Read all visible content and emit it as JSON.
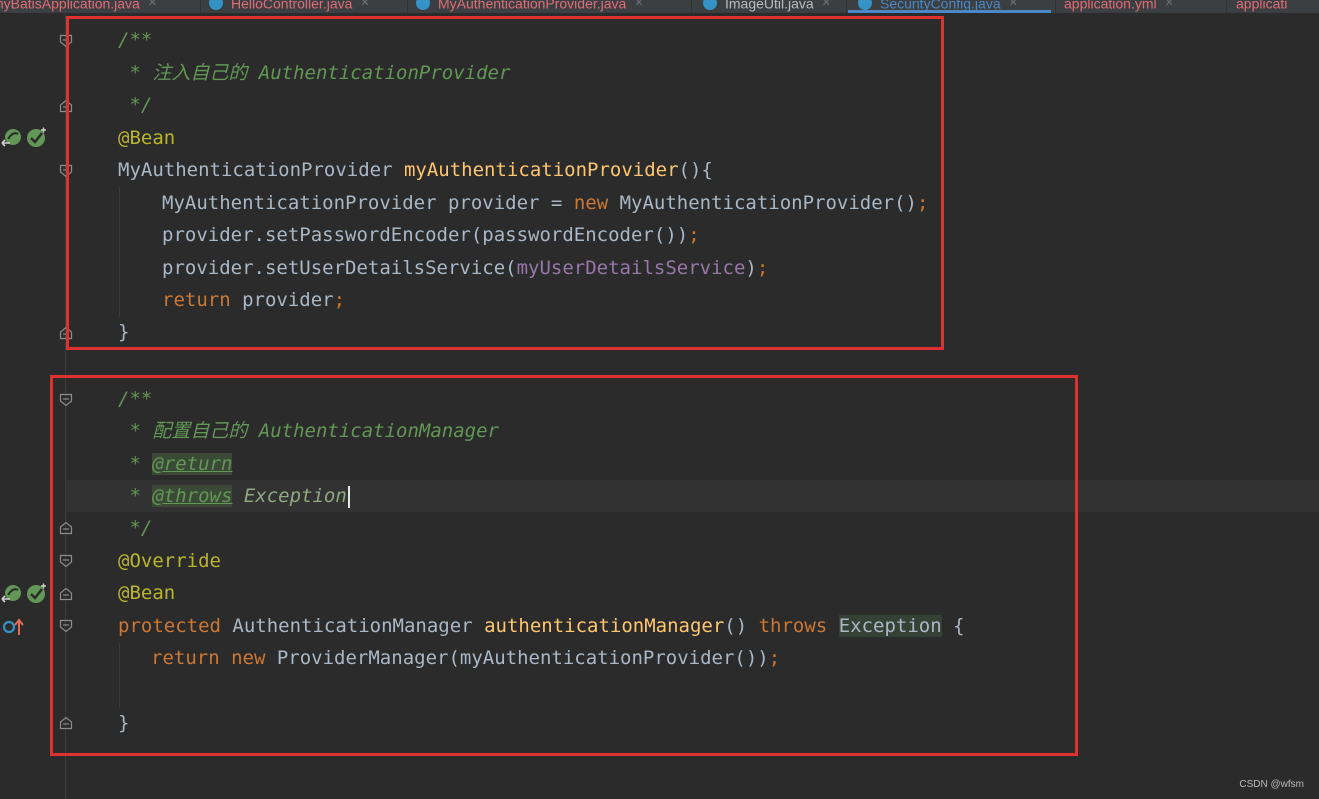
{
  "tabs": [
    {
      "label": "myBatisApplication.java",
      "state": "error"
    },
    {
      "label": "HelloController.java",
      "state": "error"
    },
    {
      "label": "MyAuthenticationProvider.java",
      "state": "error"
    },
    {
      "label": "ImageUtil.java",
      "state": "normal"
    },
    {
      "label": "SecurityConfig.java",
      "state": "active"
    },
    {
      "label": "application.yml",
      "state": "error"
    },
    {
      "label": "applicati",
      "state": "error"
    }
  ],
  "code": {
    "l1": "/**",
    "l2": " * 注入自己的 AuthenticationProvider",
    "l3": " */",
    "l4": "@Bean",
    "l5_type": "MyAuthenticationProvider ",
    "l5_fn": "myAuthenticationProvider",
    "l5_tail": "(){",
    "l6_a": "MyAuthenticationProvider provider = ",
    "l6_kw": "new",
    "l6_b": " MyAuthenticationProvider()",
    "l6_semi": ";",
    "l7_a": "provider.setPasswordEncoder(passwordEncoder())",
    "l7_semi": ";",
    "l8_a": "provider.setUserDetailsService(",
    "l8_field": "myUserDetailsService",
    "l8_b": ")",
    "l8_semi": ";",
    "l9_kw": "return",
    "l9_a": " provider",
    "l9_semi": ";",
    "l10": "}",
    "l11": "/**",
    "l12": " * 配置自己的 AuthenticationManager",
    "l13_star": " * ",
    "l13_tag": "@return",
    "l14_star": " * ",
    "l14_tag": "@throws",
    "l14_exc": "Exception",
    "l15": " */",
    "l16": "@Override",
    "l17": "@Bean",
    "l18_kw": "protected",
    "l18_type": " AuthenticationManager ",
    "l18_fn": "authenticationManager",
    "l18_paren": "() ",
    "l18_throws": "throws",
    "l18_exc": "Exception",
    "l18_tail": " {",
    "l19_kw1": "return",
    "l19_kw2": "new",
    "l19_a": " ProviderManager(myAuthenticationProvider())",
    "l19_semi": ";",
    "l20": "}"
  },
  "watermark": "CSDN @wfsm",
  "colors": {
    "background": "#2b2b2b",
    "comment": "#629755",
    "keyword": "#cc7832",
    "annotation": "#bbb529",
    "function": "#ffc66d",
    "field": "#9876aa",
    "text": "#a9b7c6",
    "highlight_box": "#e03131"
  }
}
